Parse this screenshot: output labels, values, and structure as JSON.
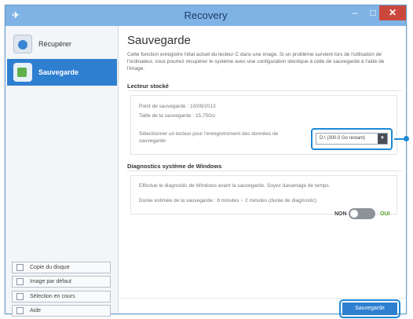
{
  "window": {
    "title": "Recovery",
    "app_icon_glyph": "✈",
    "controls": {
      "minimize": "–",
      "maximize": "□",
      "close": "✕"
    }
  },
  "sidebar": {
    "items": [
      {
        "label": "Récupérer",
        "icon": "restore-icon",
        "active": false
      },
      {
        "label": "Sauvegarde",
        "icon": "backup-icon",
        "active": true
      }
    ],
    "buttons": [
      {
        "label": "Copie du disque",
        "icon": "disk-copy-icon"
      },
      {
        "label": "Image par défaut",
        "icon": "default-image-icon"
      },
      {
        "label": "Sélection en cours",
        "icon": "selection-icon"
      },
      {
        "label": "Aide",
        "icon": "help-icon"
      }
    ]
  },
  "main": {
    "title": "Sauvegarde",
    "description": "Cette fonction enregistre l'état actuel du lecteur C dans une image. Si un problème survient lors de l'utilisation de l'ordinateur, vous pourrez récupérer le système avec une configuration identique à celle de sauvegarde à l'aide de l'image.",
    "stacked_drive": {
      "title": "Lecteur stocké",
      "backup_point_label": "Point de sauvegarde : 10/09/2013",
      "backup_size_label": "Taille de la sauvegarde : 15,75Go",
      "select_prompt": "Sélectionner un lecteur pour l'enregistrement des données de sauvegarde",
      "select_value": "D:\\ (300.0 Go restant)"
    },
    "diagnostics": {
      "title": "Diagnostics système de Windows",
      "description": "Effectue le diagnostic de Windows avant la sauvegarde. Soyez davantage de temps.",
      "duration": "Durée estimée de la sauvegarde : 8 minutes ~ 2 minutes (durée de diagnostic)",
      "toggle_off_label": "NON",
      "toggle_on_label": "OUI",
      "toggle_state": "off"
    },
    "primary_button": "Sauvegarde"
  },
  "colors": {
    "titlebar": "#7fb2e5",
    "accent": "#2f7fd1",
    "highlight": "#1e88d6",
    "close": "#c9483b",
    "toggle_on": "#5aa02c"
  }
}
